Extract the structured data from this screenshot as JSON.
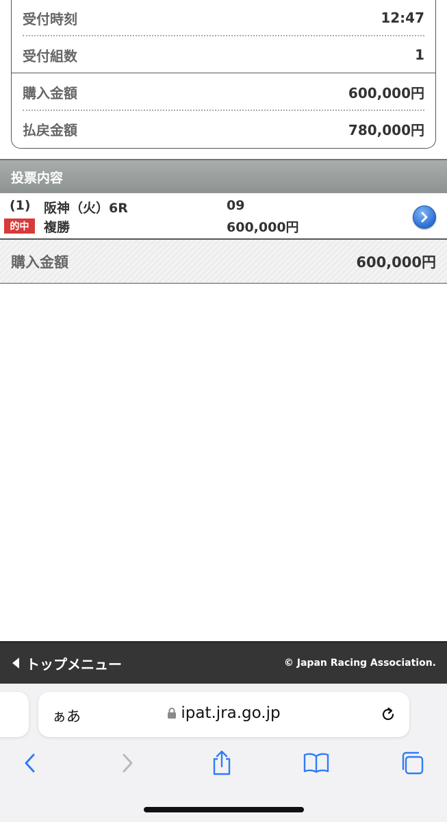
{
  "summary": {
    "rows": [
      {
        "label": "受付時刻",
        "value": "12:47"
      },
      {
        "label": "受付組数",
        "value": "1"
      },
      {
        "label": "購入金額",
        "value": "600,000円"
      },
      {
        "label": "払戻金額",
        "value": "780,000円"
      }
    ]
  },
  "bet_section": {
    "title": "投票内容",
    "entry": {
      "index": "(1)",
      "race": "阪神（火）6R",
      "number": "09",
      "badge": "的中",
      "bet_type": "複勝",
      "amount": "600,000円"
    },
    "total_label": "購入金額",
    "total_value": "600,000円"
  },
  "footer": {
    "top_menu_label": "トップメニュー",
    "copyright": "© Japan Racing Association."
  },
  "browser": {
    "aa_label": "ぁあ",
    "url": "ipat.jra.go.jp"
  },
  "colors": {
    "hit_badge": "#d83a3a",
    "section_header": "#9a9f9d",
    "footer_bar": "#353535",
    "ios_blue": "#2f7cf6"
  }
}
